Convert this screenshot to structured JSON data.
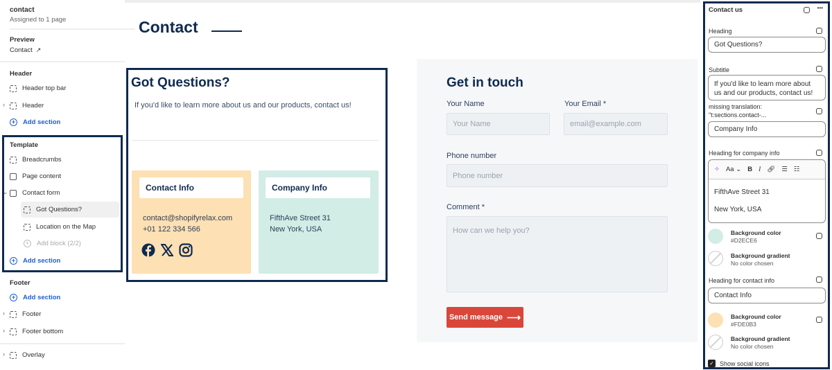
{
  "sidebar": {
    "template_name": "contact",
    "assigned": "Assigned to 1 page",
    "preview_label": "Preview",
    "preview_value": "Contact",
    "header_group": "Header",
    "header_items": [
      "Header top bar",
      "Header"
    ],
    "add_section": "Add section",
    "template_group": "Template",
    "template_items": [
      "Breadcrumbs",
      "Page content",
      "Contact form"
    ],
    "blocks": [
      "Got Questions?",
      "Location on the Map"
    ],
    "add_block": "Add block (2/2)",
    "footer_group": "Footer",
    "footer_items": [
      "Footer",
      "Footer bottom"
    ],
    "overlay": "Overlay"
  },
  "preview": {
    "page_title": "Contact",
    "heading": "Got Questions?",
    "subtitle": "If you'd like to learn more about us and our products, contact us!",
    "contact_card": {
      "heading": "Contact Info",
      "email": "contact@shopifyrelax.com",
      "phone": "+01 122 334 566",
      "bg": "#FDE0B3",
      "social": [
        "facebook-icon",
        "x-icon",
        "instagram-icon"
      ]
    },
    "company_card": {
      "heading": "Company Info",
      "line1": "FifthAve Street 31",
      "line2": "New York, USA",
      "bg": "#D2ECE6"
    },
    "form": {
      "title": "Get in touch",
      "name_label": "Your Name",
      "name_placeholder": "Your Name",
      "email_label": "Your Email *",
      "email_placeholder": "email@example.com",
      "phone_label": "Phone number",
      "phone_placeholder": "Phone number",
      "comment_label": "Comment *",
      "comment_placeholder": "How can we help you?",
      "submit": "Send message",
      "submit_color": "#D9473A"
    }
  },
  "settings": {
    "title": "Contact us",
    "more": "•••",
    "heading_label": "Heading",
    "heading_value": "Got Questions?",
    "subtitle_label": "Subtitle",
    "subtitle_value": "If you'd like to learn more about us and our products, contact us!",
    "missing_label_1": "missing translation:",
    "missing_label_2": "\"t:sections.contact-...",
    "missing_value": "Company Info",
    "company_info_label": "Heading for company info",
    "company_rt_line1": "FifthAve Street 31",
    "company_rt_line2": "New York, USA",
    "font_btn": "Aa",
    "bg_color_label": "Background color",
    "company_bg": "#D2ECE6",
    "company_bg_text": "#D2ECE6",
    "gradient_label": "Background gradient",
    "gradient_value": "No color chosen",
    "contact_info_label": "Heading for contact info",
    "contact_info_value": "Contact Info",
    "contact_bg": "#FDE0B3",
    "contact_bg_text": "#FDE0B3",
    "show_social": "Show social icons",
    "show_social_checked": true
  }
}
